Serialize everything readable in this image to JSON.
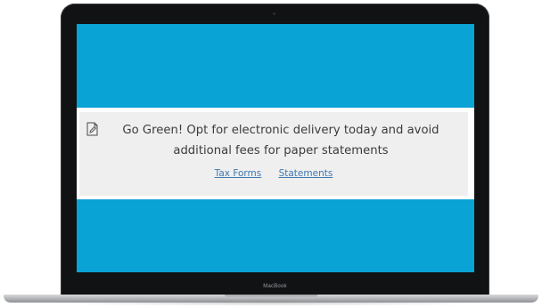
{
  "device": {
    "brand_label": "MacBook"
  },
  "banner": {
    "icon": "document-edit-icon",
    "message": "Go Green! Opt for electronic delivery today and avoid additional fees for paper statements",
    "links": [
      {
        "label": "Tax Forms"
      },
      {
        "label": "Statements"
      }
    ]
  },
  "colors": {
    "screen_background": "#0aa3d6",
    "banner_background": "#efefef",
    "link": "#3f78b2",
    "text": "#3c3c3c"
  }
}
